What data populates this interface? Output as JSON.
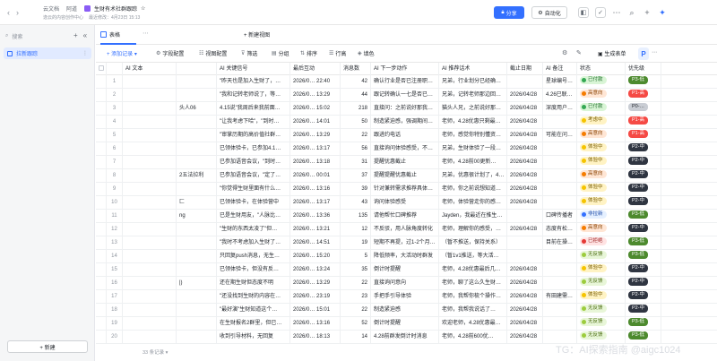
{
  "topbar": {
    "crumbs": [
      "云文档",
      "阿道"
    ],
    "doc_title": "生财有术社群跟踪",
    "doc_star": "☆",
    "sub_owner": "逸云的内容创作中心",
    "sub_modified": "最近修改：4月23日 15:13",
    "share_label": "分享",
    "auto_label": "自动化"
  },
  "sidebar": {
    "search_placeholder": "搜索",
    "item_label": "拉新跟踪",
    "new_label": "+ 新建"
  },
  "tabs": {
    "grid_label": "表格",
    "new_view": "+ 新建视图"
  },
  "toolbar": {
    "add_record": "+ 添加记录 ▾",
    "field_config": "字段配置",
    "view_config": "视图配置",
    "filter": "筛选",
    "group": "分组",
    "sort": "排序",
    "row_height": "行高",
    "fill_color": "填色",
    "generate": "生成表单"
  },
  "columns": [
    "",
    "AI 文本",
    "",
    "AI 关键信号",
    "最后互动",
    "消息数",
    "AI 下一步动作",
    "AI 推荐话术",
    "截止日期",
    "AI 备注",
    "状态",
    "优先级"
  ],
  "rows": [
    {
      "idx": "1",
      "c1": "",
      "c2": "",
      "c3": "\"昨天也是加入生财了，…",
      "c4": "2026/0… 22:40",
      "c5": "42",
      "c6": "确认行业是否已注册职…",
      "c7": "兄弟，行业划分已经确…",
      "c8": "",
      "c9": "星球编号…",
      "st": "已付款",
      "pri": "P3-低"
    },
    {
      "idx": "2",
      "c1": "",
      "c2": "",
      "c3": "\"我和记转老师说了，等…",
      "c4": "2026/0… 13:29",
      "c5": "44",
      "c6": "跟记转确认一七是否已…",
      "c7": "兄弟，记转老师那边回…",
      "c8": "2026/04/28",
      "c9": "4.26已联…",
      "st": "高意向",
      "pri": "P1-高"
    },
    {
      "idx": "3",
      "c1": "",
      "c2": "头人06",
      "c3": "4.15说\"我周后来我前面…",
      "c4": "2026/0… 15:02",
      "c5": "218",
      "c6": "直接问：之前说好那我…",
      "c7": "猫头人兄，之前说好那…",
      "c8": "2026/04/28",
      "c9": "深度用户…",
      "st": "已付款",
      "pri": "P0-…"
    },
    {
      "idx": "4",
      "c1": "",
      "c2": "",
      "c3": "\"让我考虑下哈\"，\"到时…",
      "c4": "2026/0… 14:01",
      "c5": "50",
      "c6": "制造紧迫感，强调期间…",
      "c7": "老师，4.28优惠只剩最…",
      "c8": "2026/04/28",
      "c9": "",
      "st": "考虑中",
      "pri": "P1-高"
    },
    {
      "idx": "5",
      "c1": "",
      "c2": "",
      "c3": "\"审掌历期的高价值社群…",
      "c4": "2026/0… 13:29",
      "c5": "22",
      "c6": "跟进约电话",
      "c7": "老师，感觉你特别懂资…",
      "c8": "2026/04/28",
      "c9": "可能在问…",
      "st": "高意向",
      "pri": "P1-高"
    },
    {
      "idx": "6",
      "c1": "",
      "c2": "",
      "c3": "已领体验卡，已参加4.1…",
      "c4": "2026/0… 13:17",
      "c5": "56",
      "c6": "直接询问体验感受，不…",
      "c7": "兄弟，生财体验了一段…",
      "c8": "2026/04/28",
      "c9": "",
      "st": "体验中",
      "pri": "P2-中"
    },
    {
      "idx": "7",
      "c1": "",
      "c2": "",
      "c3": "已参加语音会议，\"到时…",
      "c4": "2026/0… 13:18",
      "c5": "31",
      "c6": "提醒优惠截止",
      "c7": "老师，4.28前00更新…",
      "c8": "2026/04/28",
      "c9": "",
      "st": "体验中",
      "pri": "P2-中"
    },
    {
      "idx": "8",
      "c1": "",
      "c2": "2五法拉利",
      "c3": "已参加语音会议，\"定了…",
      "c4": "2026/0… 00:01",
      "c5": "37",
      "c6": "提醒提醒优惠截止",
      "c7": "兄弟，优惠很计划了，4…",
      "c8": "2026/04/28",
      "c9": "",
      "st": "高意向",
      "pri": "P2-中"
    },
    {
      "idx": "9",
      "c1": "",
      "c2": "",
      "c3": "\"你觉得生财里面有什么…",
      "c4": "2026/0… 13:16",
      "c5": "39",
      "c6": "针对兼转需求推荐具体…",
      "c7": "老师，你之前说想知道…",
      "c8": "2026/04/28",
      "c9": "",
      "st": "体验中",
      "pri": "P2-中"
    },
    {
      "idx": "10",
      "c1": "",
      "c2": "匚",
      "c3": "已领体验卡，在体验营中",
      "c4": "2026/0… 13:17",
      "c5": "43",
      "c6": "询问体验感受",
      "c7": "老师，体验营走你的感…",
      "c8": "2026/04/28",
      "c9": "",
      "st": "体验中",
      "pri": "P2-中"
    },
    {
      "idx": "11",
      "c1": "",
      "c2": "ng",
      "c3": "已是生财用友，\"人脉比…",
      "c4": "2026/0… 13:36",
      "c5": "135",
      "c6": "请他帮忙口碑推荐",
      "c7": "Jayden，我最近在推生…",
      "c8": "",
      "c9": "口碑传播者",
      "st": "非拉新",
      "pri": "P3-低"
    },
    {
      "idx": "12",
      "c1": "",
      "c2": "",
      "c3": "\"生财的东西太凌了\"但…",
      "c4": "2026/0… 13:21",
      "c5": "12",
      "c6": "不反驳，用人脉角度转化",
      "c7": "老师，理解你的感受，…",
      "c8": "2026/04/28",
      "c9": "态度有松…",
      "st": "高意向",
      "pri": "P2-中"
    },
    {
      "idx": "13",
      "c1": "",
      "c2": "",
      "c3": "\"我时不考虑加入生财了…",
      "c4": "2026/0… 14:51",
      "c5": "19",
      "c6": "短期不再提，过1-2个月…",
      "c7": "（暂不推送，保持关系）",
      "c8": "",
      "c9": "目前在操…",
      "st": "已拒绝",
      "pri": "P3-低"
    },
    {
      "idx": "14",
      "c1": "",
      "c2": "",
      "c3": "只回复push消息，无生…",
      "c4": "2026/0… 15:20",
      "c5": "5",
      "c6": "降低频率，大活动时群发",
      "c7": "（暂1v1推送，等大活…",
      "c8": "",
      "c9": "",
      "st": "无反馈",
      "pri": "P3-低"
    },
    {
      "idx": "15",
      "c1": "",
      "c2": "",
      "c3": "已领体验卡，但没有反…",
      "c4": "2026/0… 13:24",
      "c5": "35",
      "c6": "倒计时提醒",
      "c7": "老师，4.28优惠最后几…",
      "c8": "2026/04/28",
      "c9": "",
      "st": "体验中",
      "pri": "P2-中"
    },
    {
      "idx": "16",
      "c1": "",
      "c2": "|)",
      "c3": "还在期生财但态度不明",
      "c4": "2026/0… 13:29",
      "c5": "22",
      "c6": "直接询问意向",
      "c7": "老师，聊了这么久生财…",
      "c8": "2026/04/28",
      "c9": "",
      "st": "无反馈",
      "pri": "P2-中"
    },
    {
      "idx": "17",
      "c1": "",
      "c2": "",
      "c3": "\"还没找到生财的内容在…",
      "c4": "2026/0… 23:19",
      "c5": "23",
      "c6": "手把手引导体验",
      "c7": "老师，我帮你梳个操作…",
      "c8": "2026/04/28",
      "c9": "有田建需…",
      "st": "体验中",
      "pri": "P2-中"
    },
    {
      "idx": "18",
      "c1": "",
      "c2": "",
      "c3": "\"最好演\"生财知道这个…",
      "c4": "2026/0… 15:01",
      "c5": "22",
      "c6": "制造紧迫感",
      "c7": "老师，我帮我说话了…",
      "c8": "2026/04/28",
      "c9": "",
      "st": "无反馈",
      "pri": "P2-中"
    },
    {
      "idx": "19",
      "c1": "",
      "c2": "",
      "c3": "在生财报名2群里，但已…",
      "c4": "2026/0… 13:16",
      "c5": "52",
      "c6": "倒计时提醒",
      "c7": "欢迎老师，4.28优惠最…",
      "c8": "2026/04/28",
      "c9": "",
      "st": "无反馈",
      "pri": "P3-低"
    },
    {
      "idx": "20",
      "c1": "",
      "c2": "",
      "c3": "收到引导材料，无回复",
      "c4": "2026/0… 18:13",
      "c5": "14",
      "c6": "4.28前群发倒计时消息",
      "c7": "老师，4.28前600优…",
      "c8": "2026/04/28",
      "c9": "",
      "st": "无反馈",
      "pri": "P3-低"
    }
  ],
  "status_styles": {
    "已付款": {
      "bg": "#d9f5d6",
      "dot": "#34a853",
      "fg": "#1f6f2b"
    },
    "高意向": {
      "bg": "#ffe6d5",
      "dot": "#f57c00",
      "fg": "#8a4200"
    },
    "考虑中": {
      "bg": "#fff3c4",
      "dot": "#f5c400",
      "fg": "#7a5d00"
    },
    "体验中": {
      "bg": "#fff3c4",
      "dot": "#f5c400",
      "fg": "#7a5d00"
    },
    "非拉新": {
      "bg": "#e5f0ff",
      "dot": "#3370ff",
      "fg": "#1d4aa8"
    },
    "已拒绝": {
      "bg": "#ffe3e3",
      "dot": "#e53935",
      "fg": "#9a1c1c"
    },
    "无反馈": {
      "bg": "#e8f6d8",
      "dot": "#9ccc3d",
      "fg": "#4a6b10"
    }
  },
  "priority_styles": {
    "P0-…": {
      "bg": "#c9cdd4"
    },
    "P1-高": {
      "bg": "#f54a45"
    },
    "P2-中": {
      "bg": "#2f3541"
    },
    "P3-低": {
      "bg": "#4d8a2e"
    }
  },
  "footer": {
    "record_count": "33 条记录 ▾"
  },
  "watermark": "TG：AI探索指南 @aigc1024"
}
